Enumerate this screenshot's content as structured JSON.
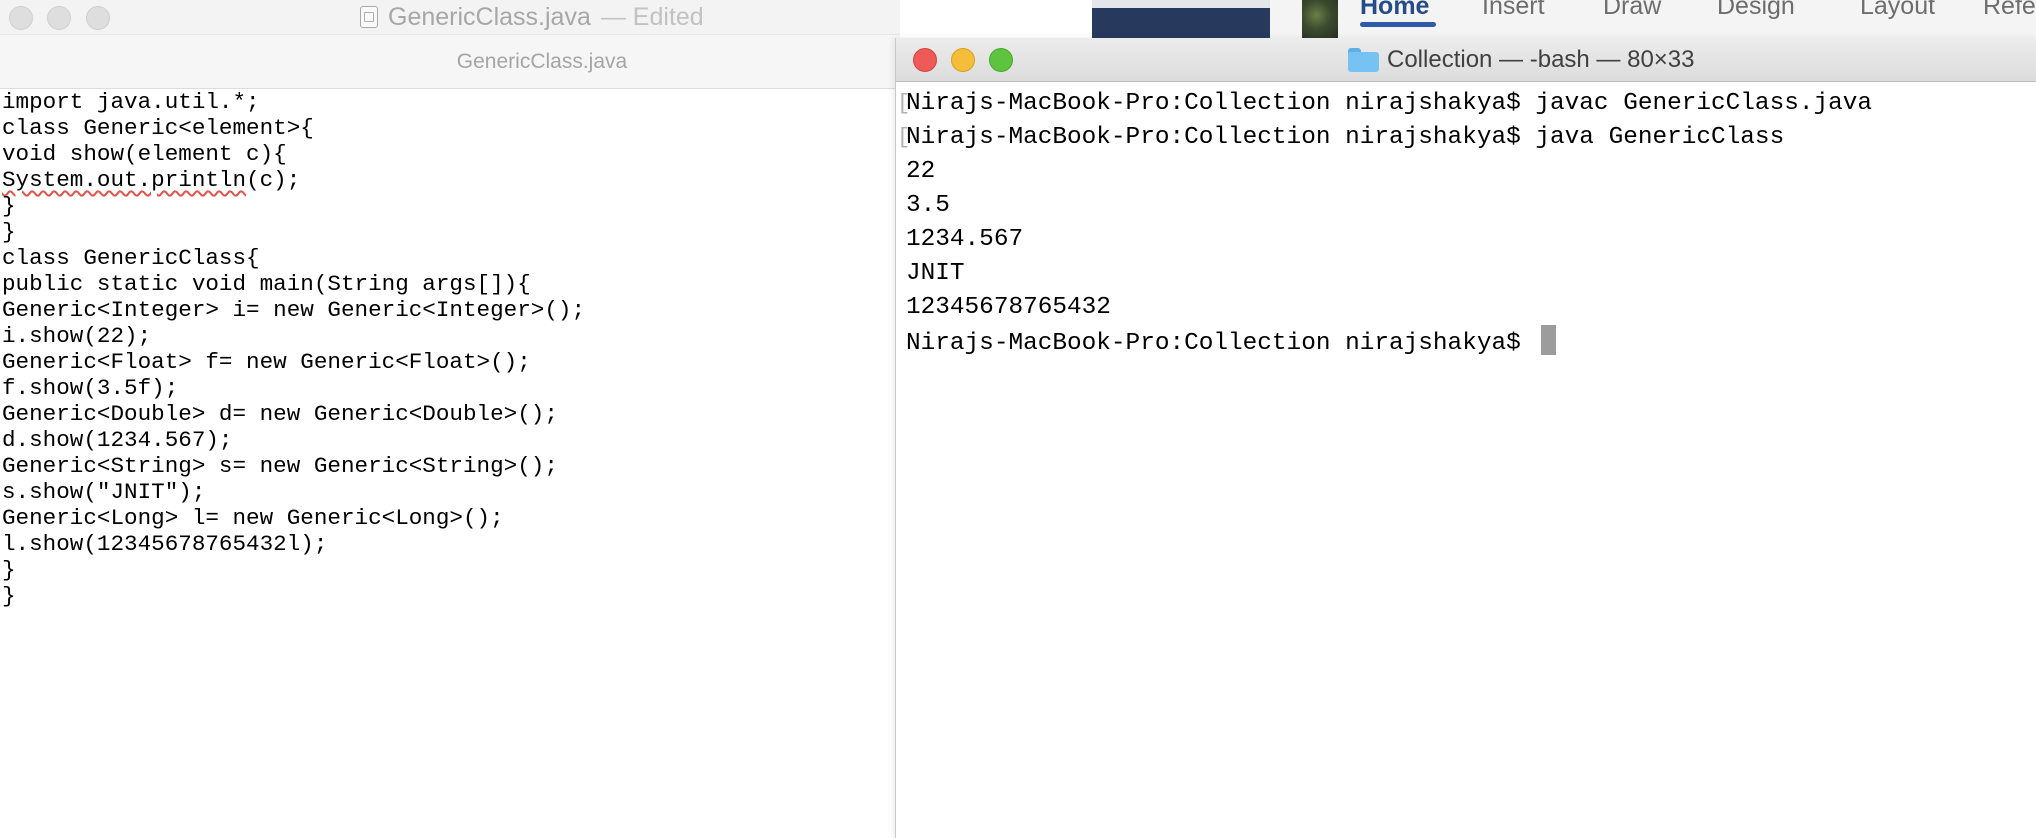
{
  "textedit": {
    "window_title": "GenericClass.java",
    "edited_status": "— Edited",
    "tab_label": "GenericClass.java",
    "code_lines": [
      "import java.util.*;",
      "class Generic<element>{",
      "void show(element c){",
      "System.out.println(c);",
      "}",
      "}",
      "class GenericClass{",
      "public static void main(String args[]){",
      "Generic<Integer> i= new Generic<Integer>();",
      "i.show(22);",
      "Generic<Float> f= new Generic<Float>();",
      "f.show(3.5f);",
      "Generic<Double> d= new Generic<Double>();",
      "d.show(1234.567);",
      "Generic<String> s= new Generic<String>();",
      "s.show(\"JNIT\");",
      "Generic<Long> l= new Generic<Long>();",
      "l.show(12345678765432l);",
      "}",
      "}"
    ],
    "squiggle_text": "System.out.println",
    "squiggle_rest": "(c);"
  },
  "word_ribbon": {
    "tabs": [
      "Home",
      "Insert",
      "Draw",
      "Design",
      "Layout",
      "Refe"
    ],
    "active_tab": "Home"
  },
  "terminal": {
    "title": "Collection — -bash — 80×33",
    "lines": [
      "Nirajs-MacBook-Pro:Collection nirajshakya$ javac GenericClass.java",
      "Nirajs-MacBook-Pro:Collection nirajshakya$ java GenericClass",
      "22",
      "3.5",
      "1234.567",
      "JNIT",
      "12345678765432"
    ],
    "prompt": "Nirajs-MacBook-Pro:Collection nirajshakya$ "
  }
}
